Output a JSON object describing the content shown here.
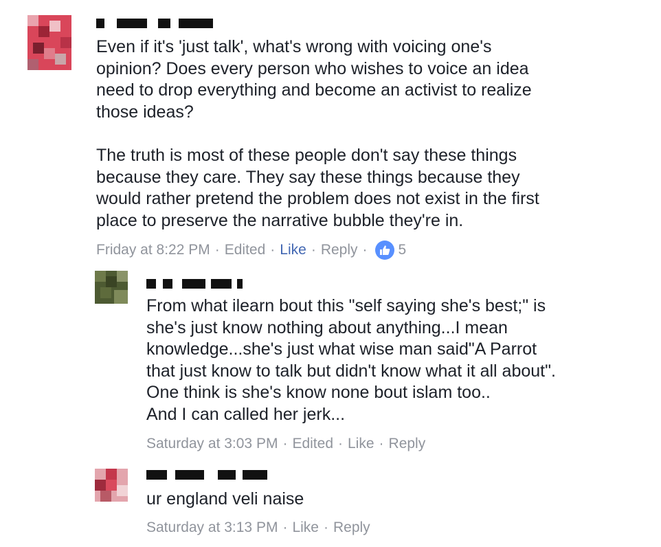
{
  "comments": [
    {
      "text": "Even if it's 'just talk', what's wrong with voicing one's\nopinion? Does every person who wishes to voice an idea\nneed to drop everything and become an activist to realize\nthose ideas?\n\nThe truth is most of these people don't say these things\nbecause they care. They say these things because they\nwould rather pretend the problem does not exist in the first\nplace to preserve the narrative bubble they're in.",
      "time": "Friday at 8:22 PM",
      "edited": "Edited",
      "like": "Like",
      "reply": "Reply",
      "reaction_count": "5",
      "like_active_color": "#4267b2"
    },
    {
      "text": "From what ilearn bout this \"self saying she's best;\" is\nshe's just know nothing about anything...I mean\nknowledge...she's just what wise man said\"A Parrot\nthat just know to talk but didn't know what it all about\".\nOne think is she's know none bout islam too..\nAnd I can called her jerk...",
      "time": "Saturday at 3:03 PM",
      "edited": "Edited",
      "like": "Like",
      "reply": "Reply"
    },
    {
      "text": "ur england veli naise",
      "time": "Saturday at 3:13 PM",
      "like": "Like",
      "reply": "Reply"
    }
  ],
  "colors": {
    "text": "#1d2129",
    "meta": "#90949c",
    "like_active": "#4267b2",
    "reaction_bubble": "#5890ff"
  },
  "icons": {
    "reaction": "thumbs-up-icon"
  }
}
